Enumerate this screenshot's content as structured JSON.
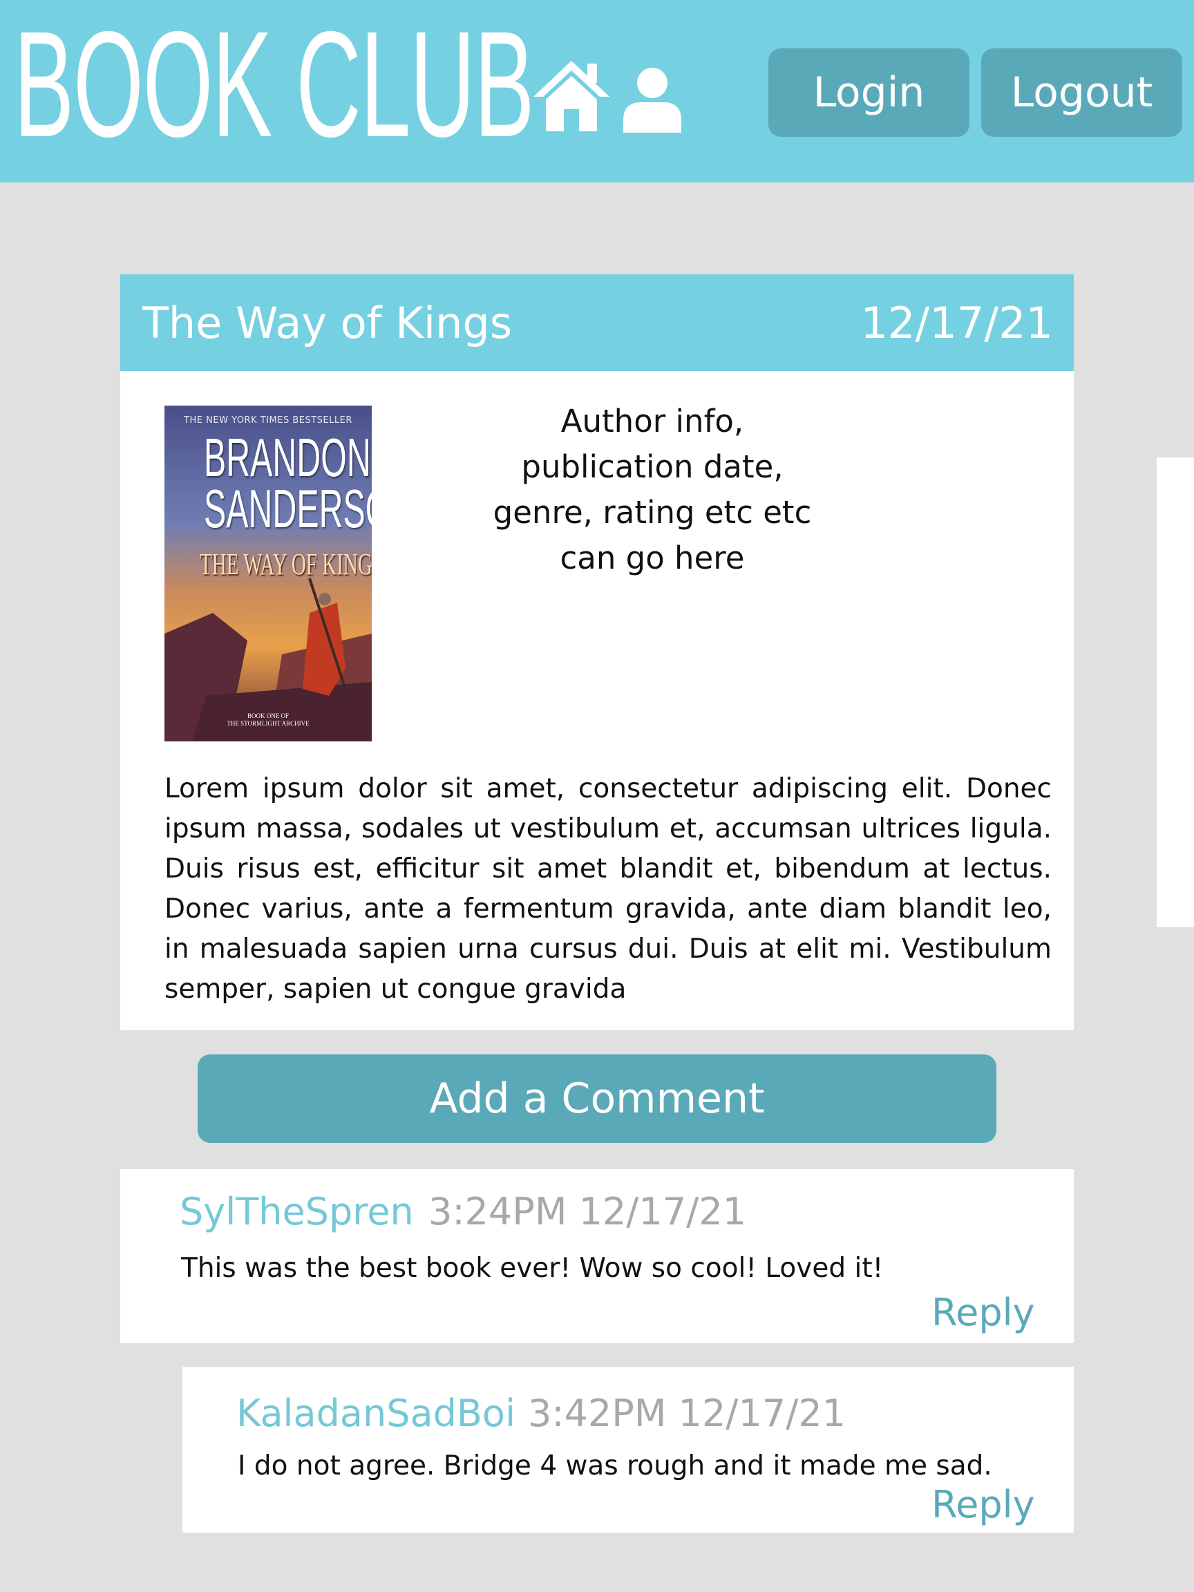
{
  "header": {
    "logo": "BOOK CLUB",
    "home_icon": "home-icon",
    "user_icon": "user-icon",
    "login_label": "Login",
    "logout_label": "Logout"
  },
  "book": {
    "title": "The Way of Kings",
    "date": "12/17/21",
    "cover": {
      "top_line": "THE NEW YORK TIMES BESTSELLER",
      "author_first": "BRANDON",
      "author_last": "SANDERSON",
      "cover_title": "THE WAY OF KINGS",
      "series_line1": "BOOK ONE OF",
      "series_line2": "THE STORMLIGHT ARCHIVE"
    },
    "info": "Author info, publication date, genre, rating etc etc can go here",
    "description": "Lorem ipsum dolor sit amet, consectetur adipiscing elit. Donec ipsum massa, sodales ut vestibulum et, accumsan ultrices ligula. Duis risus est, efficitur sit amet blandit et, bibendum at lectus. Donec varius, ante a fermentum gravida, ante diam blandit leo, in malesuada sapien urna cursus dui. Duis at elit mi. Vestibulum semper, sapien ut congue gravida"
  },
  "add_comment_label": "Add a Comment",
  "comments": [
    {
      "user": "SylTheSpren",
      "time": "3:24PM 12/17/21",
      "text": "This was the best book ever! Wow so cool! Loved it!",
      "reply_label": "Reply"
    },
    {
      "user": "KaladanSadBoi",
      "time": "3:42PM 12/17/21",
      "text": "I do not agree. Bridge 4 was rough and it made me sad.",
      "reply_label": "Reply"
    }
  ],
  "colors": {
    "accent": "#75d0e2",
    "button": "#5aa9b9",
    "background": "#e0e0e0",
    "username": "#75c8d6",
    "timestamp": "#a8a8a8"
  }
}
